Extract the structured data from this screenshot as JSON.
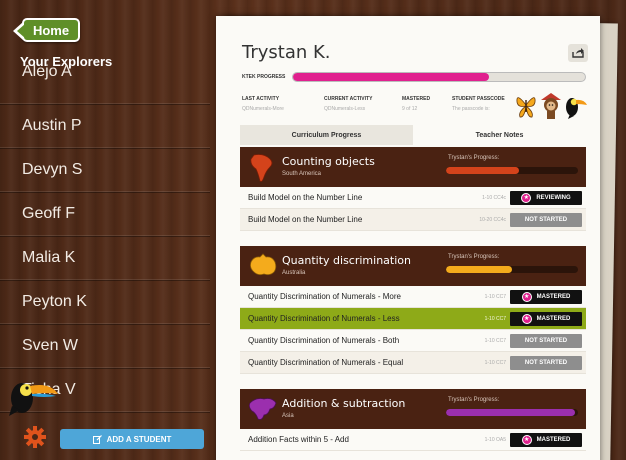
{
  "sidebar": {
    "home_label": "Home",
    "explorers_title": "Your Explorers",
    "students": [
      "Alejo A",
      "Austin P",
      "Devyn S",
      "Geoff F",
      "Malia K",
      "Peyton K",
      "Sven W",
      "Tisha V"
    ],
    "add_student_label": "ADD A STUDENT"
  },
  "student": {
    "name": "Trystan K.",
    "ktek_label": "KTEK PROGRESS",
    "ktek_progress": 0.67,
    "last_activity_label": "LAST ACTIVITY",
    "last_activity_value": "QDNumerals-More",
    "current_activity_label": "CURRENT ACTIVITY",
    "current_activity_value": "QDNumerals-Less",
    "mastered_label": "MASTERED",
    "mastered_value": "9 of 12",
    "passcode_label": "STUDENT PASSCODE",
    "passcode_value": "The passcode is:"
  },
  "tabs": [
    "Curriculum Progress",
    "Teacher Notes"
  ],
  "sections": [
    {
      "title": "Counting objects",
      "subtitle": "South America",
      "progress_label": "Trystan's Progress:",
      "progress": 0.55,
      "color": "#d4431b",
      "rows": [
        {
          "lesson": "Build Model on the Number Line",
          "standard": "1-10 CC4c",
          "status": "REVIEWING"
        },
        {
          "lesson": "Build Model on the Number Line",
          "standard": "10-20 CC4c",
          "status": "NOT STARTED"
        }
      ]
    },
    {
      "title": "Quantity discrimination",
      "subtitle": "Australia",
      "progress_label": "Trystan's Progress:",
      "progress": 0.5,
      "color": "#f4ab1c",
      "rows": [
        {
          "lesson": "Quantity Discrimination of Numerals - More",
          "standard": "1-10 CC7",
          "status": "MASTERED"
        },
        {
          "lesson": "Quantity Discrimination of Numerals - Less",
          "standard": "1-10 CC7",
          "status": "MASTERED"
        },
        {
          "lesson": "Quantity Discrimination of Numerals - Both",
          "standard": "1-10 CC7",
          "status": "NOT STARTED"
        },
        {
          "lesson": "Quantity Discrimination of Numerals - Equal",
          "standard": "1-10 CC7",
          "status": "NOT STARTED"
        }
      ]
    },
    {
      "title": "Addition & subtraction",
      "subtitle": "Asia",
      "progress_label": "Trystan's Progress:",
      "progress": 0.98,
      "color": "#9b2fae",
      "rows": [
        {
          "lesson": "Addition Facts within 5 - Add",
          "standard": "1-10 OA5",
          "status": "MASTERED"
        }
      ]
    }
  ],
  "icons": {
    "home": "back-arrow-icon",
    "gear": "gear-icon",
    "add": "edit-icon",
    "share": "share-icon",
    "star": "star-icon"
  },
  "colors": {
    "accent_pink": "#e0208e",
    "home_green": "#5f8f28",
    "add_blue": "#4ea6d8",
    "highlight_green": "#8eaa18"
  }
}
